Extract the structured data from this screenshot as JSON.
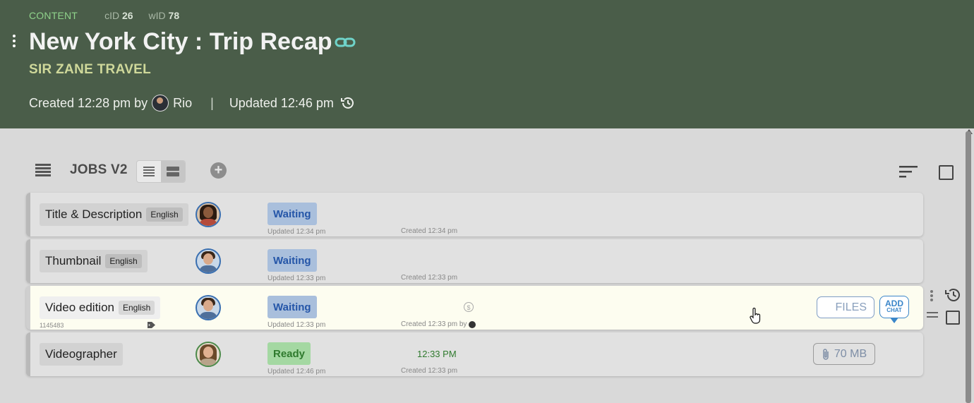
{
  "header": {
    "content_label": "CONTENT",
    "cid_label": "cID",
    "cid_value": "26",
    "wid_label": "wID",
    "wid_value": "78",
    "title": "New York City : Trip Recap",
    "client": "SIR ZANE TRAVEL",
    "created_text": "Created 12:28 pm by",
    "created_by": "Rio",
    "separator": "|",
    "updated_text": "Updated 12:46 pm"
  },
  "toolbar": {
    "title": "JOBS V2",
    "add_symbol": "+"
  },
  "jobs": [
    {
      "name": "Title & Description",
      "language": "English",
      "status": "Waiting",
      "updated": "Updated 12:34 pm",
      "created": "Created 12:34 pm"
    },
    {
      "name": "Thumbnail",
      "language": "English",
      "status": "Waiting",
      "updated": "Updated 12:33 pm",
      "created": "Created 12:33 pm"
    },
    {
      "name": "Video edition",
      "language": "English",
      "status": "Waiting",
      "updated": "Updated 12:33 pm",
      "created": "Created 12:33 pm by",
      "job_id": "1145483",
      "dollar_symbol": "$",
      "files_label": "FILES",
      "add_chat_line1": "ADD",
      "add_chat_line2": "CHAT"
    },
    {
      "name": "Videographer",
      "status": "Ready",
      "updated": "Updated 12:46 pm",
      "created": "Created 12:33 pm",
      "ready_time": "12:33 PM",
      "attachment_size": "70 MB"
    }
  ],
  "colors": {
    "header_bg": "#4a5d49",
    "waiting_bg": "#a9bfdc",
    "ready_bg": "#a4d8a2",
    "accent_link": "#6fd3c9"
  },
  "icons": [
    "kebab-icon",
    "link-icon",
    "history-icon",
    "list-menu-icon",
    "compact-view-icon",
    "expanded-view-icon",
    "add-icon",
    "sort-icon",
    "checkbox-icon",
    "tag-icon",
    "dollar-icon",
    "paperclip-icon",
    "drag-handle-icon",
    "cursor-hand-icon"
  ]
}
